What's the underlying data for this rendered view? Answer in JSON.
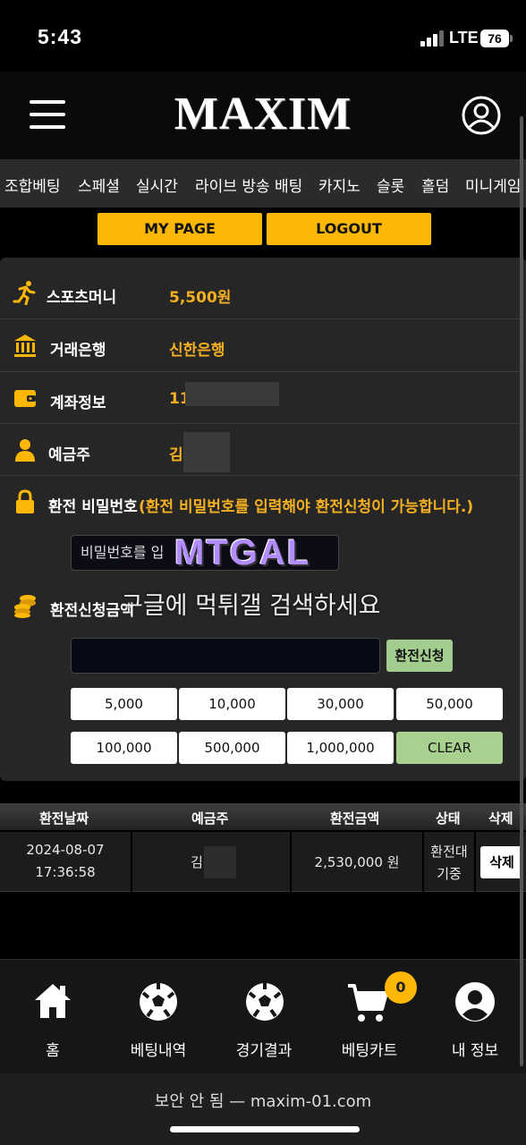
{
  "status": {
    "time": "5:43",
    "network": "LTE",
    "battery": "76"
  },
  "header": {
    "logo": "MAXIM"
  },
  "nav": [
    "조합베팅",
    "스페셜",
    "실시간",
    "라이브 방송 배팅",
    "카지노",
    "슬롯",
    "홀덤",
    "미니게임"
  ],
  "actions": {
    "mypage": "MY PAGE",
    "logout": "LOGOUT"
  },
  "account": {
    "sports_money_label": "스포츠머니",
    "sports_money_value": "5,500원",
    "bank_label": "거래은행",
    "bank_value": "신한은행",
    "account_label": "계좌정보",
    "account_value": "11",
    "holder_label": "예금주",
    "holder_value": "김",
    "password_label": "환전 비밀번호",
    "password_note": "(환전 비밀번호를 입력해야 환전신청이 가능합니다.)",
    "password_placeholder": "비밀번호를 입",
    "withdraw_label": "환전신청금액",
    "withdraw_button": "환전신청"
  },
  "amounts": [
    "5,000",
    "10,000",
    "30,000",
    "50,000",
    "100,000",
    "500,000",
    "1,000,000"
  ],
  "clear_label": "CLEAR",
  "watermark": {
    "logo": "MTGAL",
    "caption": "구글에 먹튀갤 검색하세요"
  },
  "table": {
    "headers": [
      "환전날짜",
      "예금주",
      "환전금액",
      "상태",
      "삭제"
    ],
    "rows": [
      {
        "date": "2024-08-07",
        "time": "17:36:58",
        "holder": "김",
        "amount": "2,530,000 원",
        "status_line1": "환전대",
        "status_line2": "기중",
        "delete": "삭제"
      }
    ]
  },
  "bottom_nav": [
    "홈",
    "베팅내역",
    "경기결과",
    "베팅카트",
    "내 정보"
  ],
  "cart_count": "0",
  "browser": {
    "url": "보안 안 됨 — maxim-01.com"
  },
  "colors": {
    "accent": "#fdb706",
    "green": "#a3cd8e",
    "value_text": "#f5b021"
  }
}
